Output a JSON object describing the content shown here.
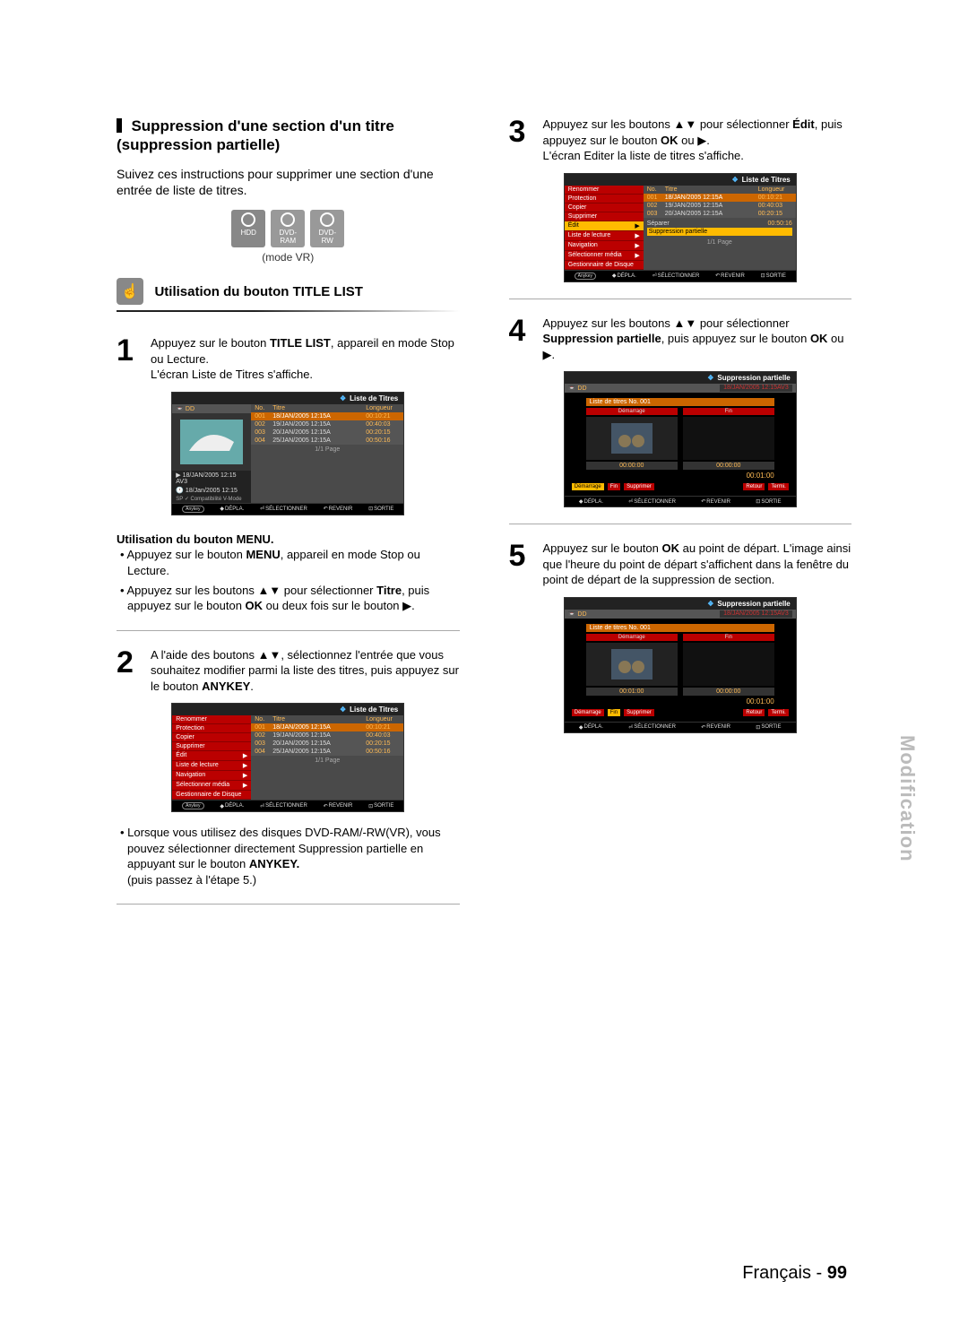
{
  "header": {
    "section_title": "Suppression d'une section d'un titre (suppression partielle)",
    "intro": "Suivez ces instructions pour supprimer une section d'une entrée de liste de titres.",
    "media": [
      "HDD",
      "DVD-RAM",
      "DVD-RW"
    ],
    "mode_note": "(mode VR)",
    "sub_title": "Utilisation du bouton TITLE LIST"
  },
  "left": {
    "step1": {
      "pre": "Appuyez sur le bouton ",
      "btn": "TITLE LIST",
      "post": ", appareil en mode Stop ou Lecture.",
      "line2": "L'écran Liste de Titres s'affiche."
    },
    "ui1": {
      "title": "Liste de Titres",
      "src": "DD",
      "cols": [
        "No.",
        "Titre",
        "Longueur"
      ],
      "rows": [
        {
          "no": "001",
          "t": "18/JAN/2005 12:15A",
          "len": "00:10:21",
          "sel": true
        },
        {
          "no": "002",
          "t": "19/JAN/2005 12:15A",
          "len": "00:40:03"
        },
        {
          "no": "003",
          "t": "20/JAN/2005 12:15A",
          "len": "00:20:15"
        },
        {
          "no": "004",
          "t": "25/JAN/2005 12:15A",
          "len": "00:50:16"
        }
      ],
      "info1": "18/JAN/2005 12:15 AV3",
      "info2": "18/Jan/2005 12:15",
      "info3": "SP ✓ Compatibilité V-Mode",
      "page": "1/1 Page",
      "foot": [
        "DÉPLA.",
        "SÉLECTIONNER",
        "REVENIR",
        "SORTIE"
      ],
      "anykey": "Anykey"
    },
    "menu_block": {
      "title": "Utilisation du bouton MENU.",
      "b1_pre": "Appuyez sur le bouton ",
      "b1_btn": "MENU",
      "b1_post": ", appareil en mode Stop ou Lecture.",
      "b2_pre": "Appuyez sur les boutons ",
      "b2_mid": " pour sélectionner ",
      "b2_btn1": "Titre",
      "b2_mid2": ", puis appuyez sur le bouton ",
      "b2_btn2": "OK",
      "b2_post": " ou deux fois sur le bouton "
    },
    "step2": {
      "pre": "A l'aide des boutons ",
      "mid": ", sélectionnez l'entrée que vous souhaitez modifier parmi la liste des titres, puis appuyez sur le bouton ",
      "btn": "ANYKEY",
      "post": "."
    },
    "ui2": {
      "title": "Liste de Titres",
      "menu": [
        "Renommer",
        "Protection",
        "Copier",
        "Supprimer",
        "Édit",
        "Liste de lecture",
        "Navigation",
        "Sélectionner média",
        "Gestionnaire de Disque"
      ],
      "cols": [
        "No.",
        "Titre",
        "Longueur"
      ],
      "rows": [
        {
          "no": "001",
          "t": "18/JAN/2005 12:15A",
          "len": "00:10:21",
          "sel": true
        },
        {
          "no": "002",
          "t": "19/JAN/2005 12:15A",
          "len": "00:40:03"
        },
        {
          "no": "003",
          "t": "20/JAN/2005 12:15A",
          "len": "00:20:15"
        },
        {
          "no": "004",
          "t": "25/JAN/2005 12:15A",
          "len": "00:50:16"
        }
      ],
      "page": "1/1 Page",
      "foot": [
        "DÉPLA.",
        "SÉLECTIONNER",
        "REVENIR",
        "SORTIE"
      ],
      "anykey": "Anykey"
    },
    "note2": {
      "t1": "Lorsque vous utilisez des disques DVD-RAM/-RW(VR), vous pouvez sélectionner directement Suppression partielle en appuyant sur le bouton ",
      "btn": "ANYKEY.",
      "t2": "(puis passez à l'étape 5.)"
    }
  },
  "right": {
    "step3": {
      "pre": "Appuyez sur les boutons ",
      "mid": " pour sélectionner ",
      "btn": "Édit",
      "mid2": ", puis appuyez sur le bouton ",
      "btn2": "OK",
      "mid3": " ou ",
      "line2": "L'écran Editer la liste de titres s'affiche."
    },
    "ui3": {
      "title": "Liste de Titres",
      "menu": [
        "Renommer",
        "Protection",
        "Copier",
        "Supprimer",
        "Édit",
        "Liste de lecture",
        "Navigation",
        "Sélectionner média",
        "Gestionnaire de Disque"
      ],
      "menu_hl": "Édit",
      "sub": [
        {
          "l": "Séparer",
          "v": "00:50:16"
        },
        {
          "l": "Suppression partielle",
          "hl": true
        }
      ],
      "cols": [
        "No.",
        "Titre",
        "Longueur"
      ],
      "rows": [
        {
          "no": "001",
          "t": "18/JAN/2005 12:15A",
          "len": "00:10:21",
          "sel": true
        },
        {
          "no": "002",
          "t": "19/JAN/2005 12:15A",
          "len": "00:40:03"
        },
        {
          "no": "003",
          "t": "20/JAN/2005 12:15A",
          "len": "00:20:15"
        }
      ],
      "page": "1/1 Page",
      "foot": [
        "DÉPLA.",
        "SÉLECTIONNER",
        "REVENIR",
        "SORTIE"
      ],
      "anykey": "Anykey"
    },
    "step4": {
      "pre": "Appuyez sur les boutons ",
      "mid": " pour sélectionner ",
      "btn": "Suppression partielle",
      "mid2": ", puis appuyez sur le bouton ",
      "btn2": "OK",
      "mid3": " ou "
    },
    "ui4": {
      "title": "Suppression partielle",
      "src": "DD",
      "rec": "18/JAN/2005 12:15AV3",
      "list_title": "Liste de titres No. 001",
      "labs": [
        "Démarrage",
        "Fin"
      ],
      "t1": "00:00:00",
      "t2": "00:00:00",
      "big": "00:01:00",
      "ctrl": [
        "Démarrage",
        "Fin",
        "Supprimer",
        "Retour",
        "Termi."
      ],
      "foot": [
        "DÉPLA.",
        "SÉLECTIONNER",
        "REVENIR",
        "SORTIE"
      ]
    },
    "step5": {
      "pre": "Appuyez sur le bouton ",
      "btn": "OK",
      "post": " au point de départ. L'image ainsi que l'heure du point de départ s'affichent dans la fenêtre du point de départ de la suppression de section."
    },
    "ui5": {
      "title": "Suppression partielle",
      "src": "DD",
      "rec": "18/JAN/2005 12:15AV3",
      "list_title": "Liste de titres No. 001",
      "labs": [
        "Démarrage",
        "Fin"
      ],
      "t1": "00:01:00",
      "t2": "00:00:00",
      "big": "00:01:00",
      "ctrl": [
        "Démarrage",
        "Fin",
        "Supprimer",
        "Retour",
        "Termi."
      ],
      "foot": [
        "DÉPLA.",
        "SÉLECTIONNER",
        "REVENIR",
        "SORTIE"
      ]
    }
  },
  "footer": {
    "lang": "Français",
    "sep": " - ",
    "page": "99"
  },
  "side": "Modification"
}
